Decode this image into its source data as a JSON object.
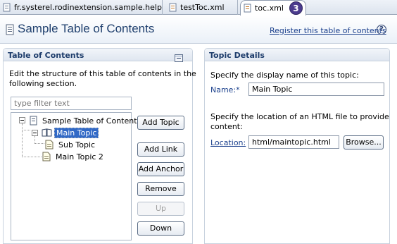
{
  "tabs": [
    {
      "label": "fr.systerel.rodinextension.sample.help",
      "active": false
    },
    {
      "label": "testToc.xml",
      "active": false
    },
    {
      "label": "toc.xml",
      "active": true
    }
  ],
  "badge": "3",
  "header": {
    "title": "Sample Table of Contents",
    "register_link": "Register this table of contents",
    "help_symbol": "?"
  },
  "left_section": {
    "title": "Table of Contents",
    "description_line1": "Edit the structure of this table of contents in the",
    "description_line2": "following section.",
    "filter_placeholder": "type filter text",
    "tree": [
      {
        "label": "Sample Table of Contents",
        "level": 0,
        "expanded": true,
        "icon": "document-icon"
      },
      {
        "label": "Main Topic",
        "level": 1,
        "expanded": true,
        "selected": true,
        "icon": "book-icon"
      },
      {
        "label": "Sub Topic",
        "level": 2,
        "icon": "page-icon"
      },
      {
        "label": "Main Topic 2",
        "level": 1,
        "icon": "page-icon"
      }
    ],
    "buttons": {
      "add_topic": "Add Topic",
      "add_link": "Add Link",
      "add_anchor": "Add Anchor",
      "remove": "Remove",
      "up": "Up",
      "down": "Down"
    }
  },
  "right_section": {
    "title": "Topic Details",
    "name_prompt": "Specify the display name of this topic:",
    "name_label": "Name:*",
    "name_value": "Main Topic",
    "location_prompt_line1": "Specify the location of an HTML file to provide",
    "location_prompt_line2": "content:",
    "location_label": "Location:",
    "location_value": "html/maintopic.html",
    "browse_label": "Browse..."
  },
  "colors": {
    "title": "#20406e",
    "link": "#1a3f8c",
    "selection": "#3169c6",
    "badge": "#4b3b8e"
  }
}
